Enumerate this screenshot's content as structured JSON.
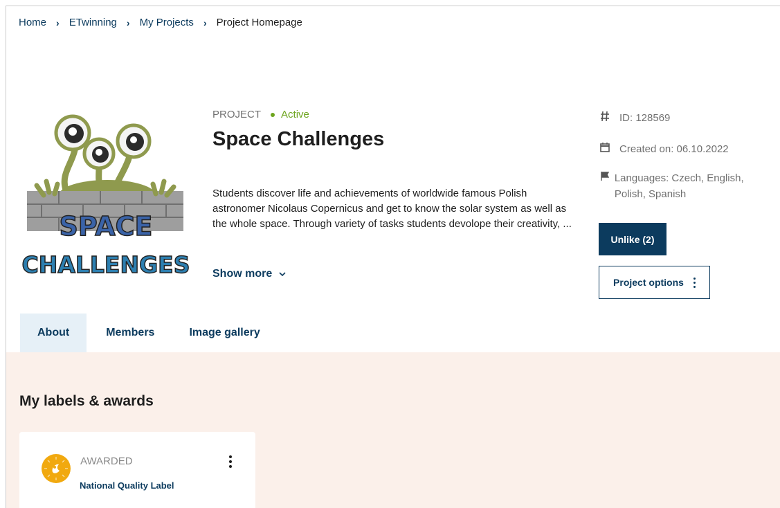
{
  "breadcrumb": {
    "items": [
      "Home",
      "ETwinning",
      "My Projects"
    ],
    "current": "Project Homepage"
  },
  "project": {
    "type_label": "PROJECT",
    "status": "Active",
    "title": "Space Challenges",
    "description": "Students discover life and achievements of worldwide famous Polish astronomer Nicolaus Copernicus and get to know the solar system as well as the whole space. Through variety of tasks students devolope their creativity, ...",
    "show_more": "Show more",
    "logo_text_1": "SPACE",
    "logo_text_2": "CHALLENGES"
  },
  "info": {
    "id": "ID: 128569",
    "created": "Created on: 06.10.2022",
    "languages": "Languages: Czech, English, Polish, Spanish"
  },
  "actions": {
    "unlike": "Unlike (2)",
    "options": "Project options"
  },
  "tabs": [
    {
      "label": "About",
      "active": true
    },
    {
      "label": "Members",
      "active": false
    },
    {
      "label": "Image gallery",
      "active": false
    }
  ],
  "awards": {
    "heading": "My labels & awards",
    "card": {
      "status": "AWARDED",
      "label": "National Quality Label",
      "icon": "quality-label-badge-icon"
    }
  },
  "colors": {
    "primary": "#0c3b5e",
    "active_status": "#6ea51e",
    "section_bg": "#fbf0ea",
    "tab_active_bg": "#e6f0f7",
    "badge": "#f1a90f"
  }
}
